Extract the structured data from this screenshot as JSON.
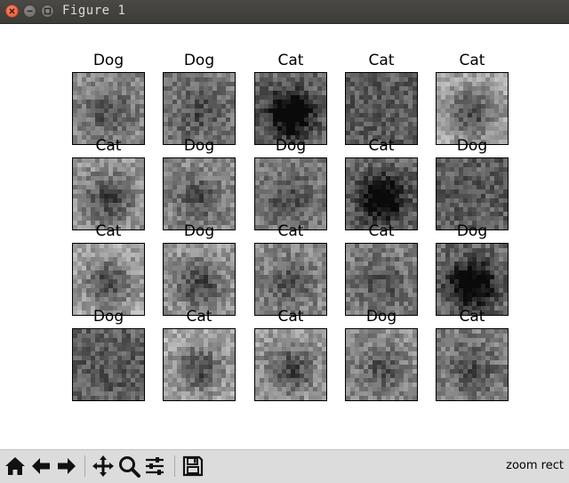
{
  "window": {
    "title": "Figure 1"
  },
  "figure": {
    "panels": [
      {
        "label": "Dog"
      },
      {
        "label": "Dog"
      },
      {
        "label": "Cat"
      },
      {
        "label": "Cat"
      },
      {
        "label": "Cat"
      },
      {
        "label": "Cat"
      },
      {
        "label": "Dog"
      },
      {
        "label": "Dog"
      },
      {
        "label": "Cat"
      },
      {
        "label": "Dog"
      },
      {
        "label": "Cat"
      },
      {
        "label": "Dog"
      },
      {
        "label": "Cat"
      },
      {
        "label": "Cat"
      },
      {
        "label": "Dog"
      },
      {
        "label": "Dog"
      },
      {
        "label": "Cat"
      },
      {
        "label": "Cat"
      },
      {
        "label": "Dog"
      },
      {
        "label": "Cat"
      }
    ]
  },
  "toolbar": {
    "buttons": [
      {
        "icon": "home-icon"
      },
      {
        "icon": "arrow-left-icon"
      },
      {
        "icon": "arrow-right-icon"
      },
      {
        "icon": "pan-icon"
      },
      {
        "icon": "zoom-icon"
      },
      {
        "icon": "sliders-icon"
      },
      {
        "icon": "save-icon"
      }
    ],
    "status": "zoom rect"
  }
}
